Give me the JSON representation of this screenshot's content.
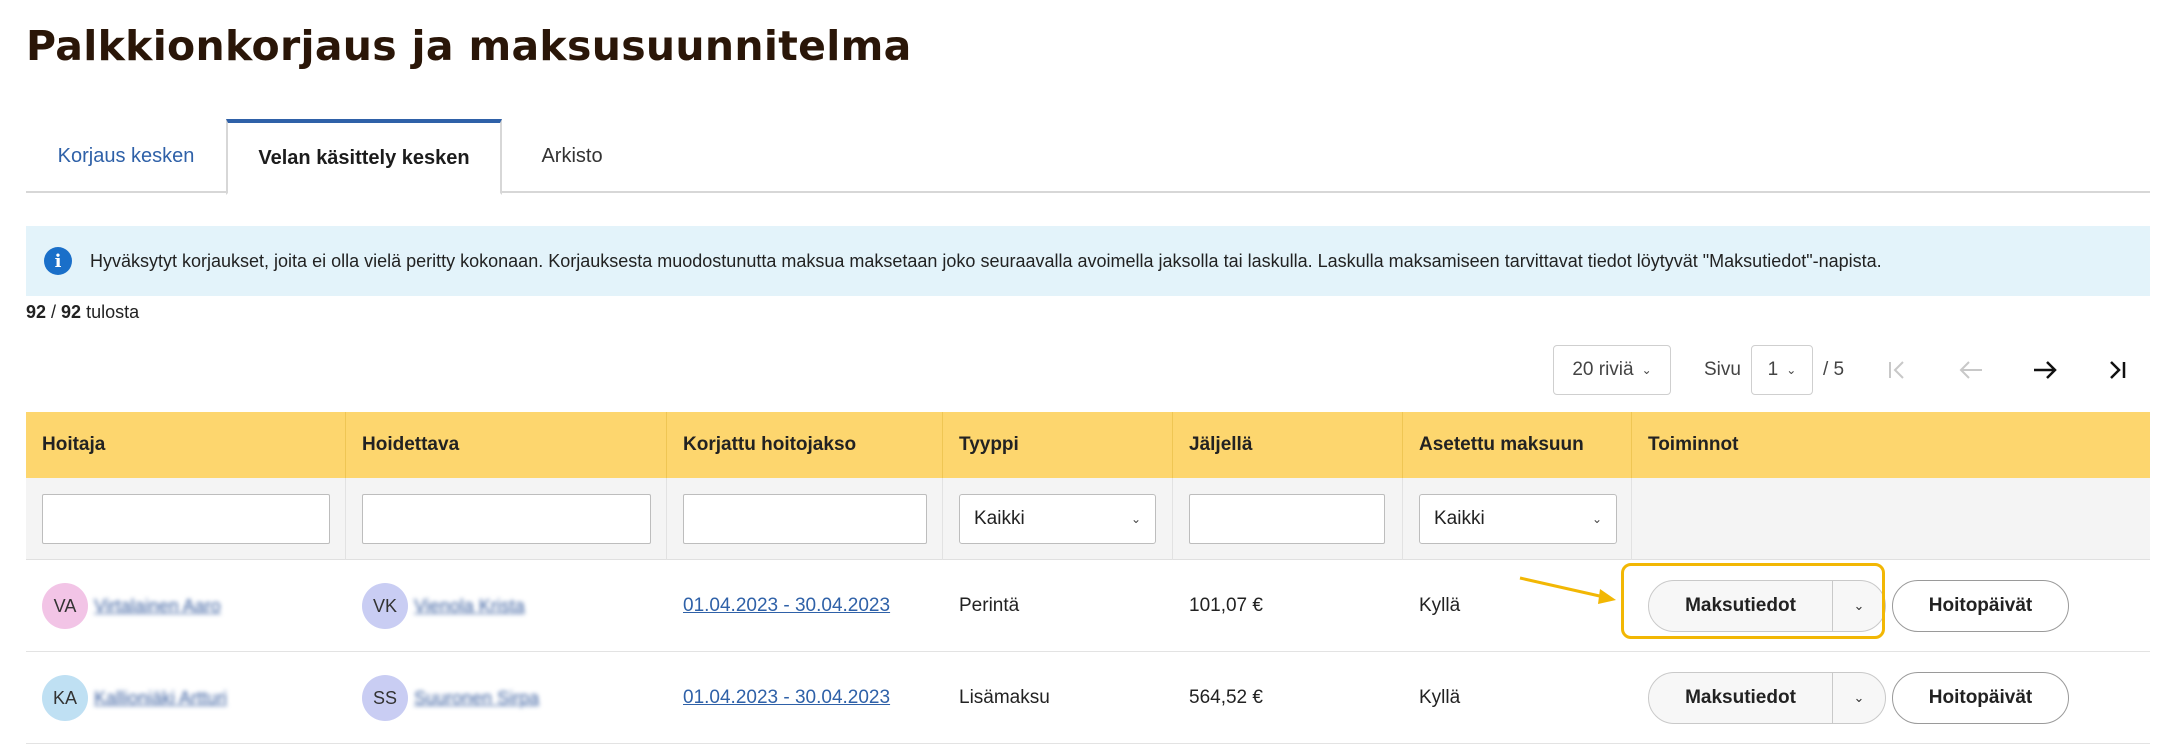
{
  "page": {
    "title": "Palkkionkorjaus ja maksusuunnitelma"
  },
  "tabs": [
    {
      "label": "Korjaus kesken"
    },
    {
      "label": "Velan käsittely kesken"
    },
    {
      "label": "Arkisto"
    }
  ],
  "info": {
    "icon": "info-icon",
    "icon_glyph": "i",
    "text": "Hyväksytyt korjaukset, joita ei olla vielä peritty kokonaan. Korjauksesta muodostunutta maksua maksetaan joko seuraavalla avoimella jaksolla tai laskulla. Laskulla maksamiseen tarvittavat tiedot löytyvät \"Maksutiedot\"-napista."
  },
  "results": {
    "shown": "92",
    "separator": " / ",
    "total": "92",
    "suffix": " tulosta"
  },
  "pager": {
    "rows_per_page": "20 riviä",
    "page_label": "Sivu",
    "current_page": "1",
    "total_pages": "/ 5"
  },
  "table": {
    "columns": [
      "Hoitaja",
      "Hoidettava",
      "Korjattu hoitojakso",
      "Tyyppi",
      "Jäljellä",
      "Asetettu maksuun",
      "Toiminnot"
    ],
    "filters": {
      "tyyppi": "Kaikki",
      "asetettu": "Kaikki"
    },
    "rows": [
      {
        "hoitaja_initials": "VA",
        "hoitaja_name": "Virtalainen Aaro",
        "hoitaja_color": "#f2c4e6",
        "hoidettava_initials": "VK",
        "hoidettava_name": "Vienola Krista",
        "hoidettava_color": "#c9cdf3",
        "jakso": "01.04.2023 - 30.04.2023",
        "tyyppi": "Perintä",
        "jaljella": "101,07 €",
        "asetettu": "Kyllä",
        "action_primary": "Maksutiedot",
        "action_secondary": "Hoitopäivät"
      },
      {
        "hoitaja_initials": "KA",
        "hoitaja_name": "Kallioniäki Artturi",
        "hoitaja_color": "#bfe0f3",
        "hoidettava_initials": "SS",
        "hoidettava_name": "Suuronen Sirpa",
        "hoidettava_color": "#c9cdf3",
        "jakso": "01.04.2023 - 30.04.2023",
        "tyyppi": "Lisämaksu",
        "jaljella": "564,52 €",
        "asetettu": "Kyllä",
        "action_primary": "Maksutiedot",
        "action_secondary": "Hoitopäivät"
      }
    ]
  },
  "colors": {
    "accent": "#2f61a8",
    "header_bg": "#fdd66e",
    "info_bg": "#e3f3fa",
    "highlight": "#f2b704"
  }
}
